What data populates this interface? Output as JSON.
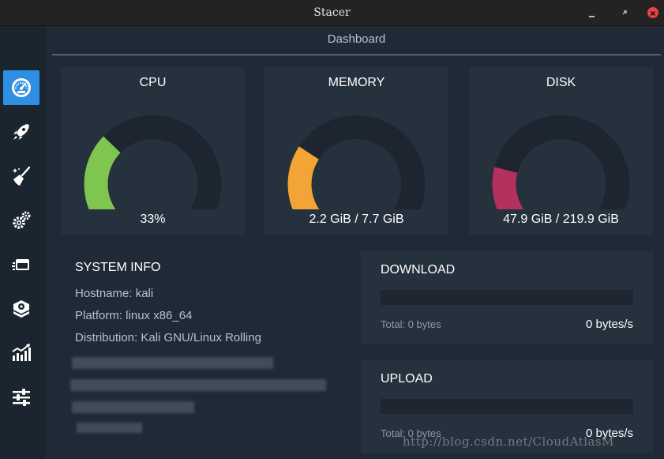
{
  "window": {
    "title": "Stacer"
  },
  "sidebar": {
    "items": [
      {
        "name": "dashboard",
        "icon": "speedometer-icon",
        "active": true
      },
      {
        "name": "startup-apps",
        "icon": "rocket-icon",
        "active": false
      },
      {
        "name": "system-cleaner",
        "icon": "broom-icon",
        "active": false
      },
      {
        "name": "services",
        "icon": "gears-icon",
        "active": false
      },
      {
        "name": "processes",
        "icon": "window-stack-icon",
        "active": false
      },
      {
        "name": "uninstaller",
        "icon": "package-icon",
        "active": false
      },
      {
        "name": "resources",
        "icon": "bar-chart-icon",
        "active": false
      },
      {
        "name": "settings",
        "icon": "sliders-icon",
        "active": false
      }
    ]
  },
  "page": {
    "title": "Dashboard"
  },
  "gauges": {
    "cpu": {
      "label": "CPU",
      "value": "33%",
      "fraction": 0.33,
      "color": "#7ec650"
    },
    "memory": {
      "label": "MEMORY",
      "value": "2.2 GiB / 7.7 GiB",
      "fraction": 0.29,
      "color": "#f2a534"
    },
    "disk": {
      "label": "DISK",
      "value": "47.9 GiB / 219.9 GiB",
      "fraction": 0.22,
      "color": "#b3305f"
    }
  },
  "system_info": {
    "title": "SYSTEM INFO",
    "hostname": "Hostname: kali",
    "platform": "Platform: linux x86_64",
    "distribution": "Distribution: Kali GNU/Linux Rolling"
  },
  "download": {
    "title": "DOWNLOAD",
    "total": "Total: 0 bytes",
    "rate": "0 bytes/s"
  },
  "upload": {
    "title": "UPLOAD",
    "total": "Total: 0 bytes",
    "rate": "0 bytes/s"
  },
  "watermark": "http://blog.csdn.net/CloudAtlasM",
  "colors": {
    "accent": "#2e8fe3",
    "background": "#1f2a36",
    "card": "#26313e",
    "gauge_track": "#1c2530"
  }
}
